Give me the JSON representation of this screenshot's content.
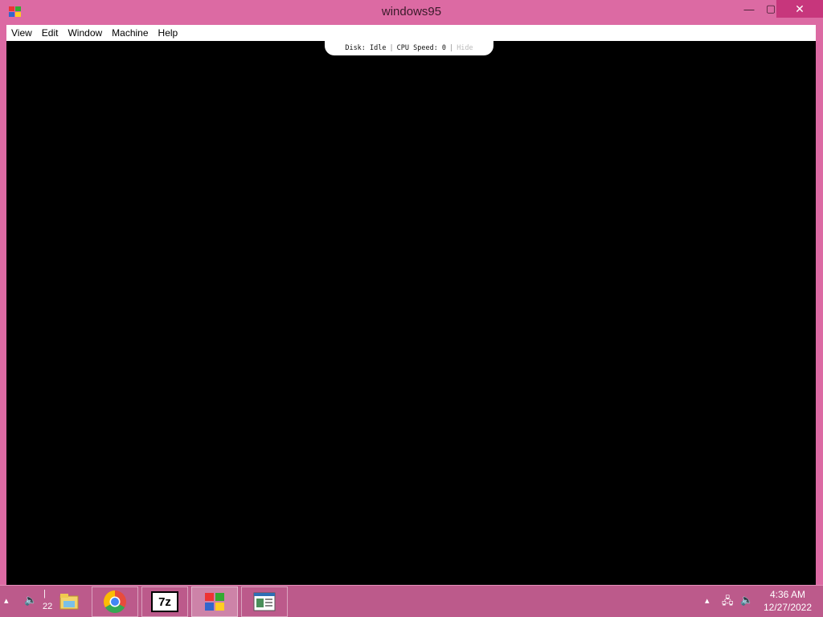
{
  "window": {
    "title": "windows95",
    "close_glyph": "✕",
    "min_glyph": "—",
    "max_glyph": "▢"
  },
  "menu": {
    "items": [
      "View",
      "Edit",
      "Window",
      "Machine",
      "Help"
    ]
  },
  "status": {
    "disk": "Disk: Idle",
    "cpu": "CPU Speed: 0",
    "hide": "Hide"
  },
  "taskbar": {
    "tray_count": "22",
    "clock_time": "4:36 AM",
    "clock_date": "12/27/2022",
    "apps": [
      {
        "name": "file-explorer-icon"
      },
      {
        "name": "chrome-icon"
      },
      {
        "name": "7zip-icon",
        "label": "7z"
      },
      {
        "name": "windows95-icon"
      },
      {
        "name": "document-window-icon"
      }
    ]
  },
  "colors": {
    "frame": "#dc6aa3",
    "close": "#c7367c",
    "taskbar": "#bc5a8b",
    "screen": "#000000"
  }
}
